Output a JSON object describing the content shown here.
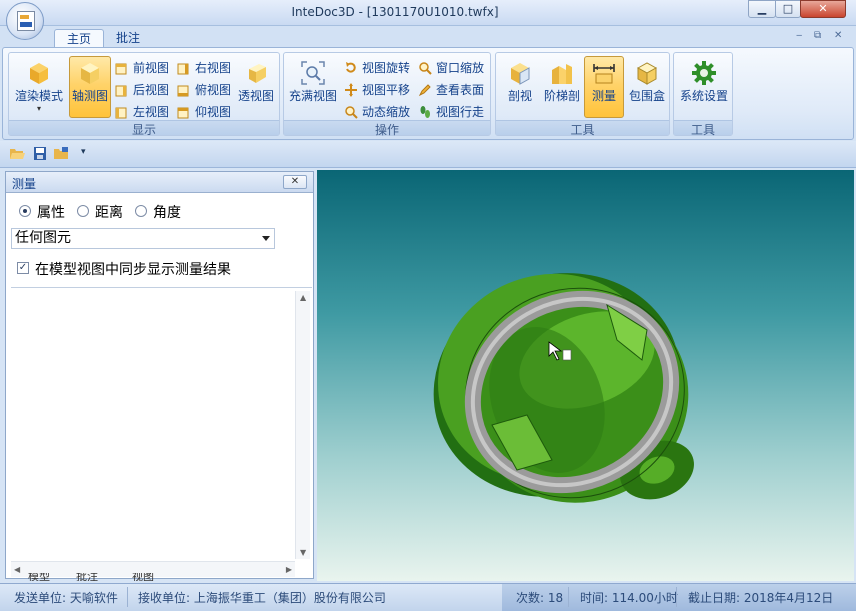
{
  "window": {
    "title": "InteDoc3D - [1301170U1010.twfx]",
    "min": "▁",
    "max": "□",
    "close": "✕"
  },
  "app_icon_label": "TWF",
  "tabs": [
    {
      "label": "主页",
      "active": true
    },
    {
      "label": "批注",
      "active": false
    }
  ],
  "mdi_controls": {
    "min": "‒",
    "restore": "⧉",
    "close": "✕"
  },
  "ribbon": {
    "display_group": {
      "label": "显示",
      "render_mode": "渲染模式",
      "axis_view": "轴测图",
      "front": "前视图",
      "back": "后视图",
      "left": "左视图",
      "right": "右视图",
      "top": "俯视图",
      "bottom": "仰视图",
      "perspective": "透视图"
    },
    "operation_group": {
      "label": "操作",
      "fit_view": "充满视图",
      "rotate": "视图旋转",
      "pan": "视图平移",
      "dynamic_zoom": "动态缩放",
      "window_zoom": "窗口缩放",
      "inspect_surface": "查看表面",
      "walk": "视图行走"
    },
    "tools_group": {
      "label": "工具",
      "section": "剖视",
      "step_section": "阶梯剖",
      "measure": "测量",
      "bounding_box": "包围盒"
    },
    "settings_group": {
      "label": "工具",
      "system_settings": "系统设置"
    }
  },
  "panel": {
    "title": "测量",
    "close": "✕",
    "radios": [
      {
        "label": "属性",
        "selected": true
      },
      {
        "label": "距离",
        "selected": false
      },
      {
        "label": "角度",
        "selected": false
      }
    ],
    "combo_value": "任何图元",
    "checkbox": {
      "label": "在模型视图中同步显示测量结果",
      "checked": true
    },
    "bottom_tabs": [
      "模型",
      "批注",
      "视图"
    ]
  },
  "statusbar": {
    "sender": "发送单位: 天喻软件",
    "receiver": "接收单位: 上海振华重工（集团）股份有限公司",
    "count": "次数: 18",
    "time": "时间: 114.00小时",
    "deadline": "截止日期: 2018年4月12日"
  },
  "colors": {
    "active_button": "#ffd36a",
    "model_green": "#3a9a16",
    "ring_gray": "#9a9a9a",
    "viewport_top": "#0a6675",
    "viewport_bottom": "#e9f4ee"
  }
}
